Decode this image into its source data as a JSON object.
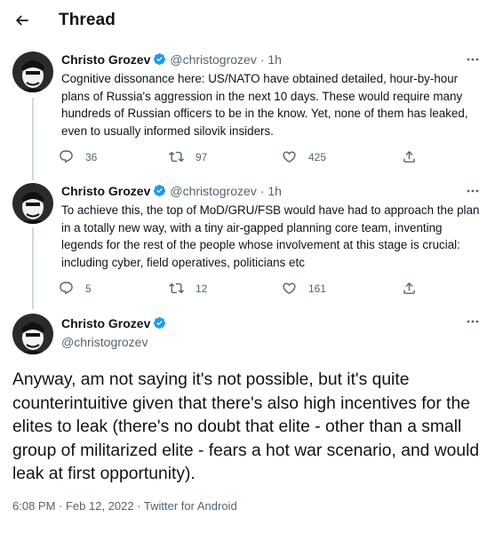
{
  "header": {
    "title": "Thread",
    "back_icon": "arrow-left-icon"
  },
  "tweets": [
    {
      "name": "Christo Grozev",
      "handle": "@christogrozev",
      "time": "· 1h",
      "text": "Cognitive dissonance here: US/NATO have obtained detailed, hour-by-hour plans of Russia's aggression in the next 10 days. These would require many hundreds of Russian officers to be in the know. Yet, none of them has leaked, even to usually informed silovik insiders.",
      "replies": "36",
      "retweets": "97",
      "likes": "425"
    },
    {
      "name": "Christo Grozev",
      "handle": "@christogrozev",
      "time": "· 1h",
      "text": "To achieve this, the top of MoD/GRU/FSB would have had to approach the plan in a totally new way, with a tiny air-gapped planning core team, inventing legends for the rest of the people whose involvement at this stage is crucial: including cyber, field operatives, politicians etc",
      "replies": "5",
      "retweets": "12",
      "likes": "161"
    }
  ],
  "main_tweet": {
    "name": "Christo Grozev",
    "handle": "@christogrozev",
    "text": "Anyway, am not saying it's not possible, but it's quite counterintuitive given that there's also high incentives for the elites to leak (there's no doubt that elite - other than a small group of militarized elite - fears a hot war scenario, and would leak at first opportunity).",
    "timestamp": "6:08 PM · Feb 12, 2022 · Twitter for Android"
  },
  "colors": {
    "text": "#0f1419",
    "secondary": "#536471",
    "verified": "#1d9bf0",
    "thread_line": "#cfd9de"
  }
}
